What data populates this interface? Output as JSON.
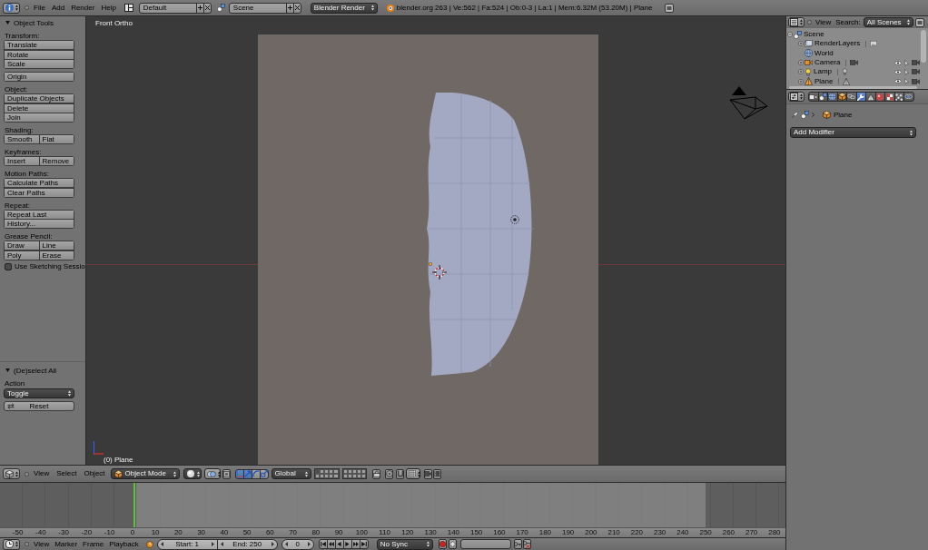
{
  "info_header": {
    "menus": [
      "File",
      "Add",
      "Render",
      "Help"
    ],
    "screen_layout": "Default",
    "scene": "Scene",
    "render_engine": "Blender Render",
    "stats": "blender.org 263 | Ve:562 | Fa:524 | Ob:0-3 | La:1 | Mem:6.32M (53.20M) | Plane"
  },
  "tool_shelf": {
    "title": "Object Tools",
    "expanded": true,
    "groups": [
      {
        "label": "Transform:",
        "blocks": [
          [
            [
              "Translate"
            ],
            [
              "Rotate"
            ],
            [
              "Scale"
            ]
          ],
          [
            [
              "Origin"
            ]
          ]
        ]
      },
      {
        "label": "Object:",
        "blocks": [
          [
            [
              "Duplicate Objects"
            ],
            [
              "Delete"
            ],
            [
              "Join"
            ]
          ]
        ]
      },
      {
        "label": "Shading:",
        "blocks": [
          [
            [
              "Smooth",
              "Flat"
            ]
          ]
        ]
      },
      {
        "label": "Keyframes:",
        "blocks": [
          [
            [
              "Insert",
              "Remove"
            ]
          ]
        ]
      },
      {
        "label": "Motion Paths:",
        "blocks": [
          [
            [
              "Calculate Paths"
            ],
            [
              "Clear Paths"
            ]
          ]
        ]
      },
      {
        "label": "Repeat:",
        "blocks": [
          [
            [
              "Repeat Last"
            ],
            [
              "History..."
            ]
          ]
        ]
      },
      {
        "label": "Grease Pencil:",
        "blocks": [
          [
            [
              "Draw",
              "Line"
            ],
            [
              "Poly",
              "Erase"
            ]
          ]
        ],
        "checkbox": {
          "label": "Use Sketching Sessio",
          "checked": false
        }
      }
    ]
  },
  "operator_panel": {
    "title": "(De)select All",
    "expanded": true,
    "field_label": "Action",
    "action": "Toggle",
    "reset": "Reset"
  },
  "viewport": {
    "view_name": "Front Ortho",
    "object_info": "(0) Plane"
  },
  "view3d_header": {
    "menus": [
      "View",
      "Select",
      "Object"
    ],
    "mode": "Object Mode",
    "manipulator": {
      "on": true
    },
    "transform_widgets": [
      {
        "kind": "translate",
        "selected": true
      },
      {
        "kind": "rotate",
        "selected": false
      },
      {
        "kind": "scale",
        "selected": false
      }
    ],
    "orientation": "Global",
    "layers": [
      {
        "selected": true
      },
      {
        "selected": false
      },
      {
        "selected": false
      },
      {
        "selected": false
      },
      {
        "selected": false
      },
      {
        "selected": false
      },
      {
        "selected": false
      },
      {
        "selected": false
      },
      {
        "selected": false
      },
      {
        "selected": false
      },
      {
        "selected": false
      },
      {
        "selected": false
      },
      {
        "selected": false
      },
      {
        "selected": false
      },
      {
        "selected": false
      },
      {
        "selected": false
      },
      {
        "selected": false
      },
      {
        "selected": false
      },
      {
        "selected": false
      },
      {
        "selected": false
      }
    ]
  },
  "timeline": {
    "ruler_labels": [
      "-50",
      "-40",
      "-30",
      "-20",
      "-10",
      "0",
      "10",
      "20",
      "30",
      "40",
      "50",
      "60",
      "70",
      "80",
      "90",
      "100",
      "110",
      "120",
      "130",
      "140",
      "150",
      "160",
      "170",
      "180",
      "190",
      "200",
      "210",
      "220",
      "230",
      "240",
      "250",
      "260",
      "270",
      "280"
    ]
  },
  "timeline_header": {
    "menus": [
      "View",
      "Marker",
      "Frame",
      "Playback"
    ],
    "start": "Start: 1",
    "end": "End: 250",
    "current_frame": "0",
    "sync": "No Sync"
  },
  "outliner": {
    "menus": [
      "View"
    ],
    "search_label": "Search:",
    "filter": "All Scenes",
    "tree": [
      {
        "label": "Scene",
        "kind": "scene",
        "expanded": true,
        "children": [
          {
            "label": "RenderLayers",
            "kind": "render_layers",
            "expanded": false
          },
          {
            "label": "World",
            "kind": "world"
          },
          {
            "label": "Camera",
            "kind": "camera",
            "expanded": false,
            "visible": true,
            "selectable": true,
            "renderable": true
          },
          {
            "label": "Lamp",
            "kind": "lamp",
            "expanded": false,
            "visible": true,
            "selectable": true,
            "renderable": true
          },
          {
            "label": "Plane",
            "kind": "mesh",
            "expanded": false,
            "visible": true,
            "selectable": true,
            "renderable": true
          }
        ]
      }
    ]
  },
  "properties": {
    "tabs": [
      {
        "kind": "render",
        "selected": false
      },
      {
        "kind": "scene",
        "selected": false
      },
      {
        "kind": "world",
        "selected": false
      },
      {
        "kind": "object",
        "selected": false
      },
      {
        "kind": "constraints",
        "selected": false
      },
      {
        "kind": "modifiers",
        "selected": true
      },
      {
        "kind": "data",
        "selected": false
      },
      {
        "kind": "material",
        "selected": false
      },
      {
        "kind": "texture",
        "selected": false
      },
      {
        "kind": "particles",
        "selected": false
      },
      {
        "kind": "physics",
        "selected": false
      }
    ],
    "breadcrumb": "Plane",
    "add_modifier": "Add Modifier"
  }
}
